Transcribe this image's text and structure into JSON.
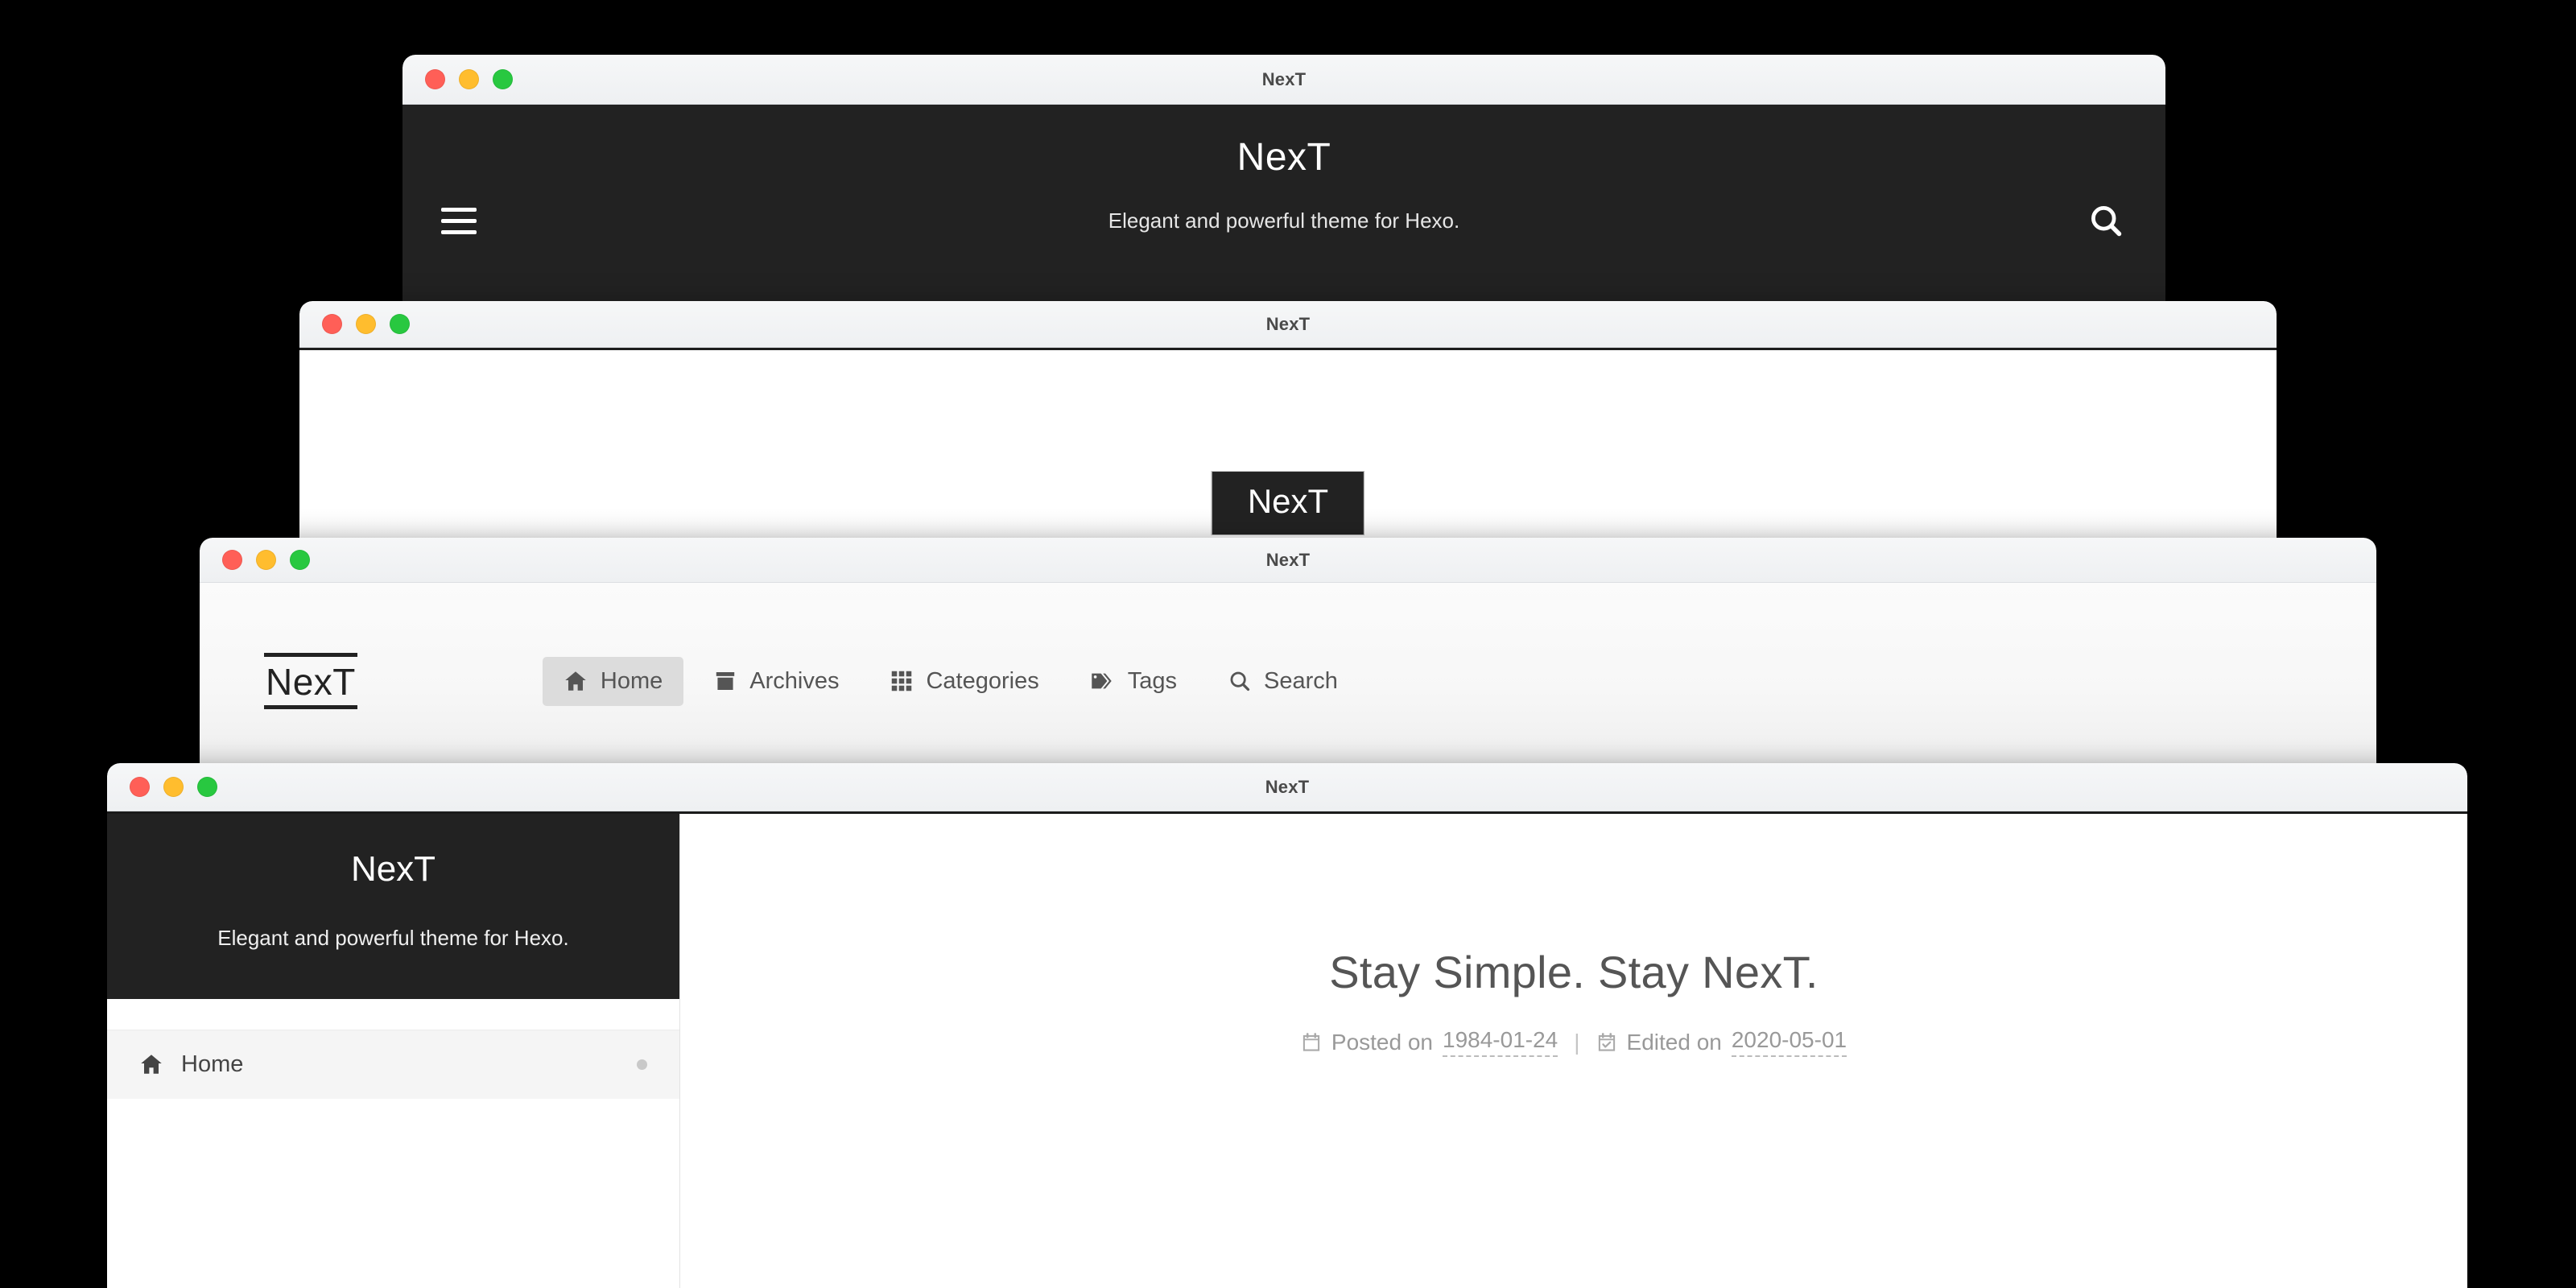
{
  "windows": {
    "pisces": {
      "title": "NexT",
      "brand": "NexT",
      "subtitle": "Elegant and powerful theme for Hexo.",
      "menu_icon": "hamburger-icon",
      "search_icon": "search-icon"
    },
    "muse": {
      "title": "NexT",
      "logo": "NexT"
    },
    "gemini": {
      "title": "NexT",
      "logo": "NexT",
      "nav": [
        {
          "label": "Home",
          "icon": "home-icon",
          "active": true
        },
        {
          "label": "Archives",
          "icon": "archive-icon",
          "active": false
        },
        {
          "label": "Categories",
          "icon": "grid-icon",
          "active": false
        },
        {
          "label": "Tags",
          "icon": "tag-icon",
          "active": false
        },
        {
          "label": "Search",
          "icon": "search-icon",
          "active": false
        }
      ]
    },
    "mist": {
      "title": "NexT",
      "sidebar": {
        "brand": "NexT",
        "subtitle": "Elegant and powerful theme for Hexo.",
        "items": [
          {
            "label": "Home",
            "icon": "home-icon"
          }
        ]
      },
      "post": {
        "title": "Stay Simple. Stay NexT.",
        "posted_label": "Posted on",
        "posted_date": "1984-01-24",
        "separator": "|",
        "edited_label": "Edited on",
        "edited_date": "2020-05-01",
        "posted_icon": "calendar-icon",
        "edited_icon": "calendar-check-icon"
      }
    }
  },
  "colors": {
    "background": "#000000",
    "dark_panel": "#222222",
    "titlebar": "#f2f4f5",
    "light_red": "#ff5f57",
    "light_yellow": "#ffbd2e",
    "light_green": "#28c840",
    "nav_active_bg": "#dcdcdc",
    "muted_text": "#999999"
  }
}
